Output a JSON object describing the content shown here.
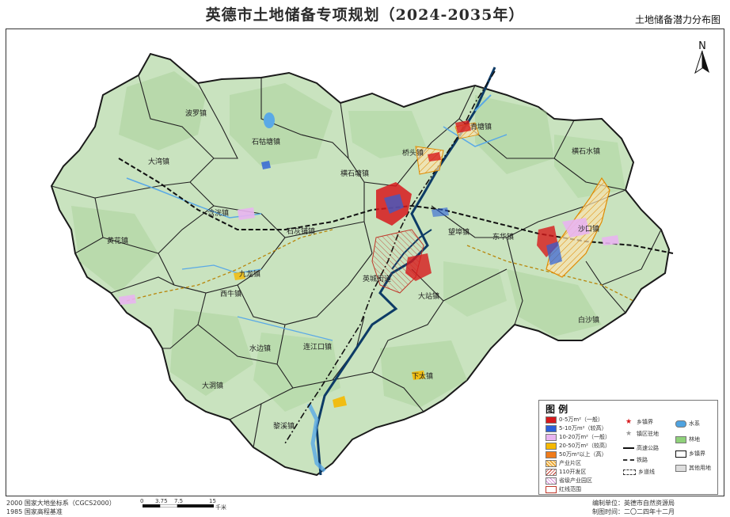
{
  "title": "英德市土地储备专项规划（2024-2035年）",
  "subtitle": "土地储备潜力分布图",
  "north_label": "N",
  "towns": [
    {
      "name": "波罗镇"
    },
    {
      "name": "石牯塘镇"
    },
    {
      "name": "大湾镇"
    },
    {
      "name": "青塘镇"
    },
    {
      "name": "横石塘镇"
    },
    {
      "name": "横石水镇"
    },
    {
      "name": "黄花镇"
    },
    {
      "name": "石灰铺镇"
    },
    {
      "name": "望埠镇"
    },
    {
      "name": "东华镇"
    },
    {
      "name": "连江口镇"
    },
    {
      "name": "九龙镇"
    },
    {
      "name": "西牛镇"
    },
    {
      "name": "英城街道"
    },
    {
      "name": "大站镇"
    },
    {
      "name": "下太镇"
    },
    {
      "name": "浛洸镇"
    },
    {
      "name": "沙口镇"
    },
    {
      "name": "白沙镇"
    },
    {
      "name": "桥头镇"
    },
    {
      "name": "水边镇"
    },
    {
      "name": "大洞镇"
    },
    {
      "name": "黎溪镇"
    }
  ],
  "legend": {
    "title": "图 例",
    "items_left": [
      {
        "label": "0-5万m²（一般）",
        "color": "#d7191c"
      },
      {
        "label": "5-10万m²（较高）",
        "color": "#2b5fd9"
      },
      {
        "label": "10-20万m²（一般）",
        "color": "#e8b4f0"
      },
      {
        "label": "20-50万m²（较高）",
        "color": "#f5b800"
      },
      {
        "label": "50万m²以上（高）",
        "color": "#f07b1a"
      },
      {
        "label": "产业片区",
        "color": "#f5d59a"
      },
      {
        "label": "110开发区",
        "color": "#ffffff"
      },
      {
        "label": "省级产业园区",
        "color": "#f0c8f0"
      },
      {
        "label": "红线范围",
        "color": "#ffffff"
      }
    ],
    "items_right": [
      {
        "label": "乡镇界",
        "color": "#d7191c"
      },
      {
        "label": "镇区驻地",
        "color": "#999999"
      },
      {
        "label": "高速公路",
        "color": "#111111"
      },
      {
        "label": "铁路",
        "color": "#333333"
      },
      {
        "label": "乡道线",
        "color": "#333333"
      }
    ],
    "items_far": [
      {
        "label": "水系",
        "color": "#4fa3e0"
      },
      {
        "label": "林地",
        "color": "#8fd17a"
      },
      {
        "label": "乡镇界",
        "color": "#ffffff"
      },
      {
        "label": "其他用地",
        "color": "#dddddd"
      }
    ]
  },
  "footer": {
    "coord_system": "2000 国家大地坐标系（CGCS2000）",
    "height_system": "1985 国家高程基准",
    "scale_ticks": [
      "0",
      "3.75",
      "7.5",
      "15"
    ],
    "scale_unit": "千米",
    "org_label": "编制单位：英德市自然资源局",
    "date_label": "制图时间：二〇二四年十二月"
  },
  "colors": {
    "land": "#cfe6c6",
    "forest": "#a9d29a",
    "river": "#0d3b66",
    "water": "#5aa9e6",
    "border": "#1a1a1a"
  }
}
